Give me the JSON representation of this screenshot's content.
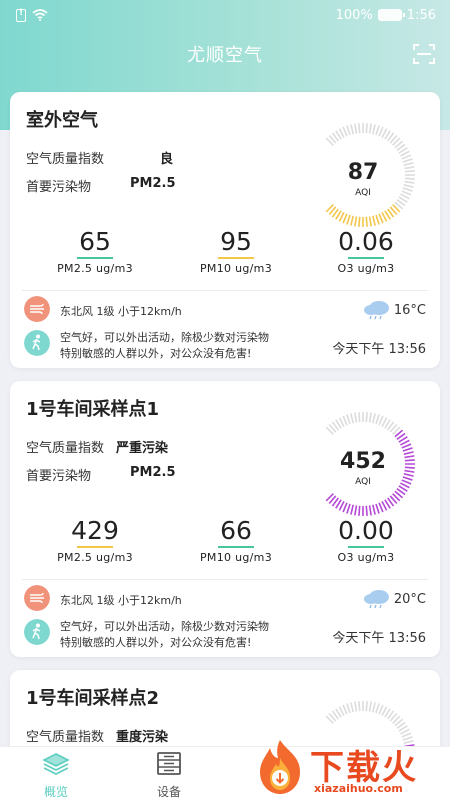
{
  "status_bar": {
    "battery": "100%",
    "time": "1:56"
  },
  "header": {
    "title": "尤顺空气"
  },
  "cards": [
    {
      "title": "室外空气",
      "aqi_label": "空气质量指数",
      "aqi_level": "良",
      "pollutant_label": "首要污染物",
      "pollutant": "PM2.5",
      "aqi": "87",
      "aqi_unit": "AQI",
      "aqi_fraction": 0.35,
      "gauge_color": "#f3c64a",
      "metrics": [
        {
          "value": "65",
          "label": "PM2.5 ug/m3",
          "bar_color": "#46c79a"
        },
        {
          "value": "95",
          "label": "PM10 ug/m3",
          "bar_color": "#f3c64a"
        },
        {
          "value": "0.06",
          "label": "O3 ug/m3",
          "bar_color": "#46c79a"
        }
      ],
      "wind": "东北风 1级 小于12km/h",
      "temperature": "16°C",
      "advice_line1": "空气好，可以外出活动，除极少数对污染物",
      "advice_line2": "特别敏感的人群以外，对公众没有危害!",
      "update_time": "今天下午 13:56"
    },
    {
      "title": "1号车间采样点1",
      "aqi_label": "空气质量指数",
      "aqi_level": "严重污染",
      "pollutant_label": "首要污染物",
      "pollutant": "PM2.5",
      "aqi": "452",
      "aqi_unit": "AQI",
      "aqi_fraction": 0.66,
      "gauge_color": "#b548d6",
      "metrics": [
        {
          "value": "429",
          "label": "PM2.5 ug/m3",
          "bar_color": "#f3c64a"
        },
        {
          "value": "66",
          "label": "PM10 ug/m3",
          "bar_color": "#46c79a"
        },
        {
          "value": "0.00",
          "label": "O3 ug/m3",
          "bar_color": "#46c79a"
        }
      ],
      "wind": "东北风 1级 小于12km/h",
      "temperature": "20°C",
      "advice_line1": "空气好，可以外出活动，除极少数对污染物",
      "advice_line2": "特别敏感的人群以外，对公众没有危害!",
      "update_time": "今天下午 13:56"
    },
    {
      "title": "1号车间采样点2",
      "aqi_label": "空气质量指数",
      "aqi_level": "重度污染",
      "aqi_fraction": 0.55,
      "gauge_color": "#b548d6"
    }
  ],
  "tabs": [
    {
      "label": "概览",
      "active": true
    },
    {
      "label": "设备",
      "active": false
    }
  ],
  "watermark": {
    "title": "下载火",
    "url": "xiazaihuo.com"
  },
  "colors": {
    "accent": "#5ccdc0",
    "tab_active": "#5ccdc0",
    "tab_inactive": "#555555"
  }
}
